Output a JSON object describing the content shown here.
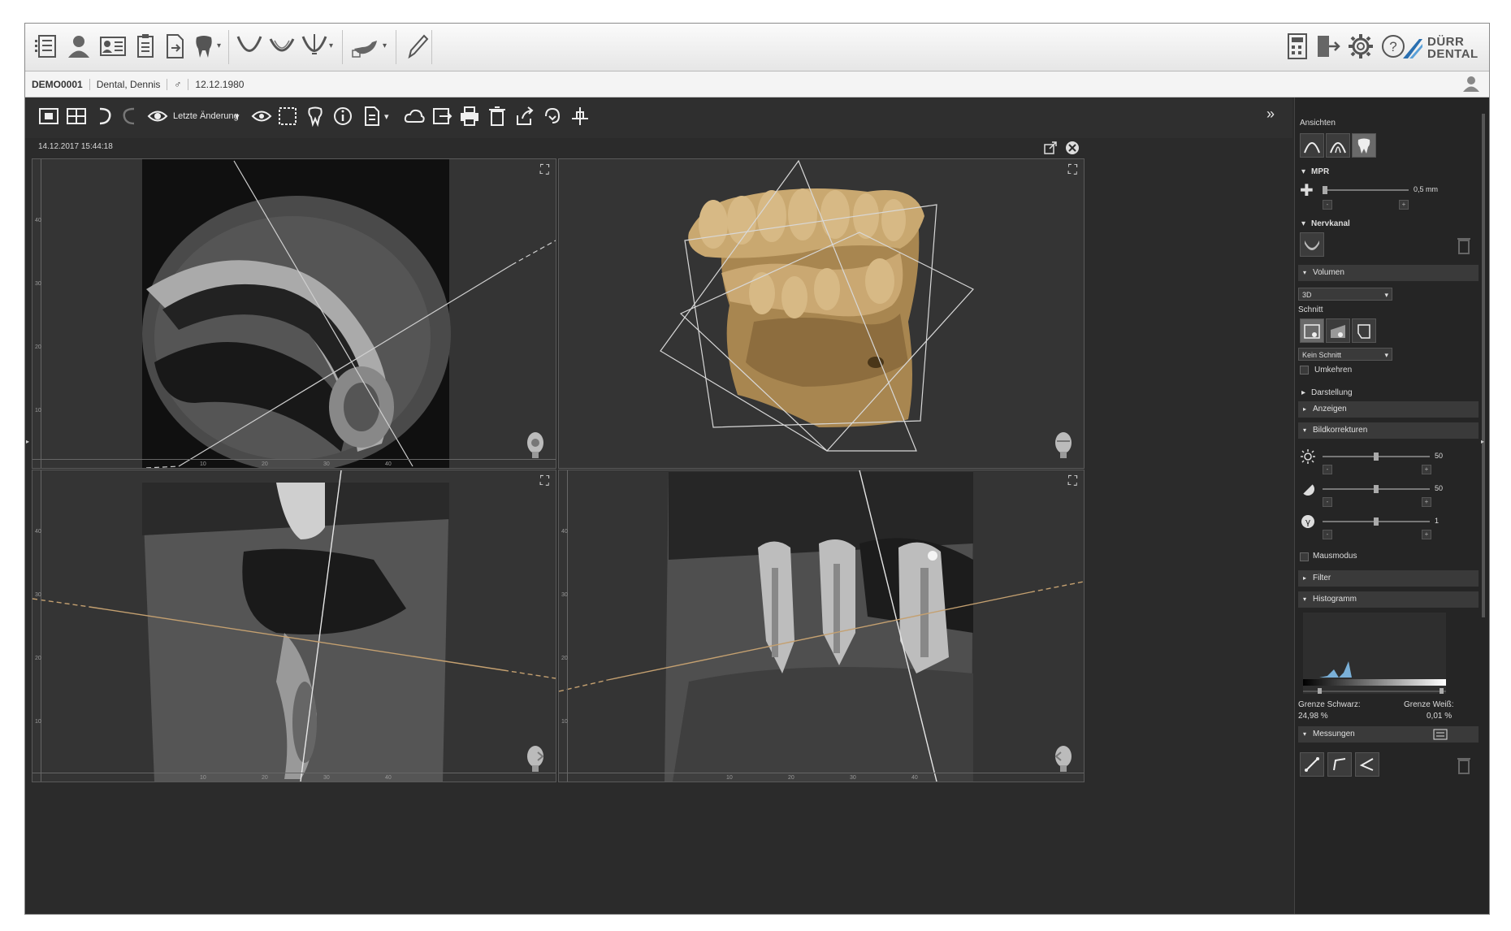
{
  "patient": {
    "id": "DEMO0001",
    "name": "Dental, Dennis",
    "sex": "♂",
    "dob": "12.12.1980"
  },
  "toolbar": {
    "last_change_label": "Letzte Änderung",
    "more_label": "»"
  },
  "brand": {
    "logo_line1": "DÜRR",
    "logo_line2": "DENTAL",
    "accent": "#2a6fb0"
  },
  "study": {
    "timestamp": "14.12.2017 15:44:18"
  },
  "viewers": {
    "ruler_labels": [
      "10",
      "20",
      "30",
      "40"
    ],
    "left_ruler_labels": [
      "40",
      "30",
      "20",
      "10"
    ]
  },
  "right_panel": {
    "ansichten_label": "Ansichten",
    "mpr_label": "MPR",
    "mpr_value": "0,5 mm",
    "nervkanal_label": "Nervkanal",
    "volumen_label": "Volumen",
    "volumen_select": "3D",
    "schnitt_label": "Schnitt",
    "schnitt_select": "Kein Schnitt",
    "umkehren_label": "Umkehren",
    "darstellung_label": "Darstellung",
    "anzeigen_label": "Anzeigen",
    "bildkorrekturen_label": "Bildkorrekturen",
    "brightness_value": "50",
    "contrast_value": "50",
    "gamma_value": "1",
    "brightness_level": 0.5,
    "contrast_level": 0.5,
    "gamma_level": 0.5,
    "mausmodus_label": "Mausmodus",
    "filter_label": "Filter",
    "histogramm_label": "Histogramm",
    "grenze_schwarz_label": "Grenze Schwarz:",
    "grenze_schwarz_value": "24,98 %",
    "grenze_weiss_label": "Grenze Weiß:",
    "grenze_weiss_value": "0,01 %",
    "messungen_label": "Messungen"
  },
  "colors": {
    "bone_gold": "#b89a62",
    "plane_line": "#d8d8d8",
    "axis_line": "#c4a070"
  }
}
